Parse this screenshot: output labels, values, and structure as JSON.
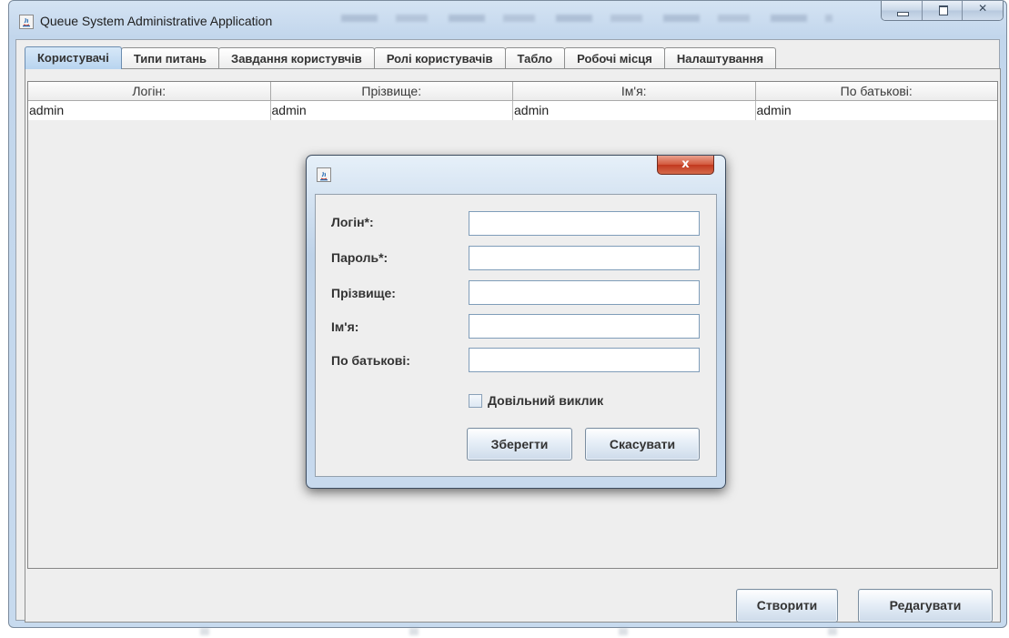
{
  "window": {
    "title": "Queue System Administrative Application",
    "close_glyph": "✕",
    "caption_icons": [
      "minimize-icon",
      "maximize-icon",
      "close-icon"
    ]
  },
  "tabs": [
    {
      "label": "Користувачі",
      "active": true
    },
    {
      "label": "Типи питань",
      "active": false
    },
    {
      "label": "Завдання користувчів",
      "active": false
    },
    {
      "label": "Ролі користувачів",
      "active": false
    },
    {
      "label": "Табло",
      "active": false
    },
    {
      "label": "Робочі місця",
      "active": false
    },
    {
      "label": "Налаштування",
      "active": false
    }
  ],
  "table": {
    "columns": [
      "Логін:",
      "Прізвище:",
      "Ім'я:",
      "По батькові:"
    ],
    "rows": [
      [
        "admin",
        "admin",
        "admin",
        "admin"
      ]
    ]
  },
  "buttons": {
    "create": "Створити",
    "edit": "Редагувати"
  },
  "dialog": {
    "close_glyph": "x",
    "fields": [
      {
        "label": "Логін*:",
        "value": ""
      },
      {
        "label": "Пароль*:",
        "value": ""
      },
      {
        "label": "Прізвище:",
        "value": ""
      },
      {
        "label": "Ім'я:",
        "value": ""
      },
      {
        "label": "По батькові:",
        "value": ""
      }
    ],
    "checkbox": {
      "label": "Довільний виклик",
      "checked": false
    },
    "save": "Зберегти",
    "cancel": "Скасувати"
  }
}
